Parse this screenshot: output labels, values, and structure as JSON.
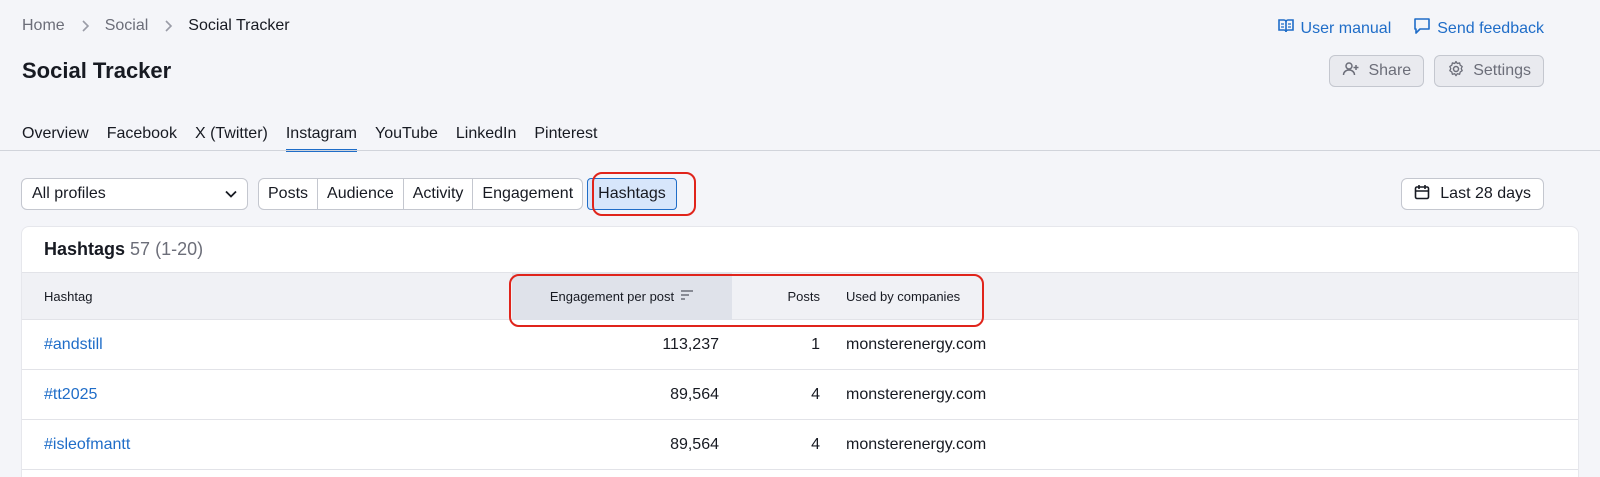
{
  "breadcrumb": {
    "items": [
      "Home",
      "Social",
      "Social Tracker"
    ]
  },
  "top_links": {
    "manual": "User manual",
    "feedback": "Send feedback"
  },
  "page": {
    "title": "Social Tracker"
  },
  "header_actions": {
    "share": "Share",
    "settings": "Settings"
  },
  "tabs": [
    "Overview",
    "Facebook",
    "X (Twitter)",
    "Instagram",
    "YouTube",
    "LinkedIn",
    "Pinterest"
  ],
  "active_tab": "Instagram",
  "filters": {
    "profile_select": "All profiles",
    "segments": [
      "Posts",
      "Audience",
      "Activity",
      "Engagement",
      "Hashtags"
    ],
    "active_segment": "Hashtags",
    "date_range": "Last 28 days"
  },
  "table": {
    "title": "Hashtags",
    "count_text": "57 (1-20)",
    "columns": {
      "hashtag": "Hashtag",
      "engagement": "Engagement per post",
      "posts": "Posts",
      "used_by": "Used by companies"
    },
    "sorted_column": "engagement",
    "rows": [
      {
        "hashtag": "#andstill",
        "engagement": "113,237",
        "posts": "1",
        "used_by": "monsterenergy.com"
      },
      {
        "hashtag": "#tt2025",
        "engagement": "89,564",
        "posts": "4",
        "used_by": "monsterenergy.com"
      },
      {
        "hashtag": "#isleofmantt",
        "engagement": "89,564",
        "posts": "4",
        "used_by": "monsterenergy.com"
      }
    ]
  },
  "colors": {
    "accent": "#1f6dc8",
    "highlight": "#e0241b",
    "background": "#f4f5f9"
  }
}
